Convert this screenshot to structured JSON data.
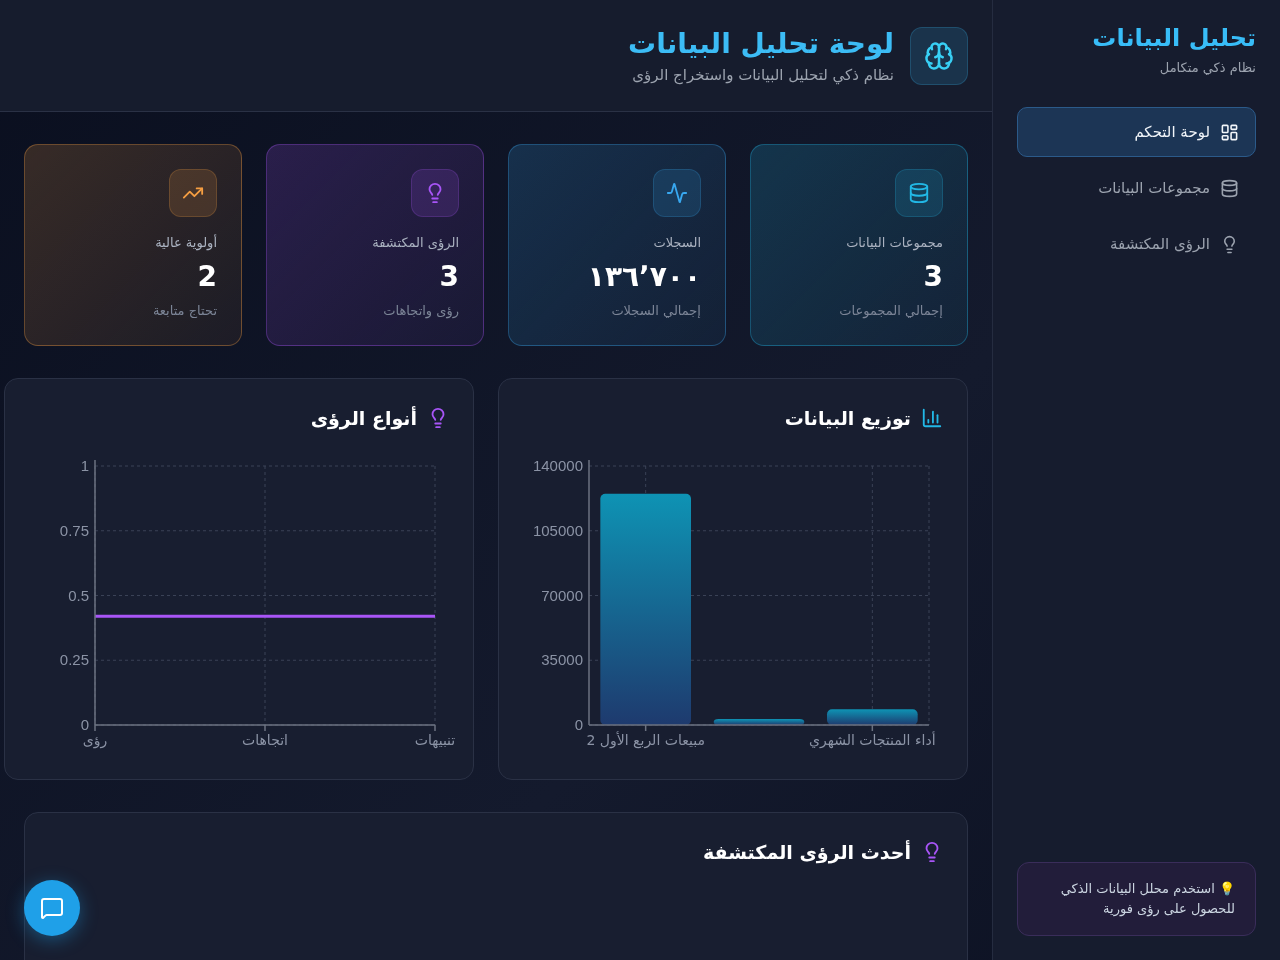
{
  "sidebar": {
    "title": "تحليل البيانات",
    "subtitle": "نظام ذكي متكامل",
    "items": [
      {
        "label": "لوحة التحكم",
        "selected": true
      },
      {
        "label": "مجموعات البيانات",
        "selected": false
      },
      {
        "label": "الرؤى المكتشفة",
        "selected": false
      }
    ],
    "tip": "💡 استخدم محلل البيانات الذكي للحصول على رؤى فورية"
  },
  "header": {
    "title": "لوحة تحليل البيانات",
    "subtitle": "نظام ذكي لتحليل البيانات واستخراج الرؤى"
  },
  "stats": [
    {
      "label": "مجموعات البيانات",
      "value": "3",
      "note": "إجمالي المجموعات",
      "color": "#22b8e6"
    },
    {
      "label": "السجلات",
      "value": "١٣٦٬٧٠٠",
      "note": "إجمالي السجلات",
      "color": "#38a8f0"
    },
    {
      "label": "الرؤى المكتشفة",
      "value": "3",
      "note": "رؤى واتجاهات",
      "color": "#a855f7"
    },
    {
      "label": "أولوية عالية",
      "value": "2",
      "note": "تحتاج متابعة",
      "color": "#f59e42"
    }
  ],
  "charts": [
    {
      "title": "توزيع البيانات",
      "chart_data": {
        "type": "bar",
        "values": [
          125000,
          3200,
          8500
        ],
        "categories": [
          "مبيعات الربع الأول 2",
          null,
          "أداء المنتجات الشهري"
        ],
        "grid": true,
        "ylim": [
          0,
          140000
        ],
        "yticks": [
          0,
          35000,
          70000,
          105000,
          140000
        ]
      }
    },
    {
      "title": "أنواع الرؤى",
      "chart_data": {
        "type": "line",
        "categories": [
          "رؤى",
          "اتجاهات",
          "تنبيهات"
        ],
        "series": [
          {
            "color": "#a855f7",
            "values": [
              0.42,
              0.42,
              0.42
            ]
          }
        ],
        "grid": true,
        "ylim": [
          0,
          1
        ],
        "yticks": [
          0,
          0.25,
          0.5,
          0.75,
          1
        ]
      }
    }
  ],
  "insights": {
    "title": "أحدث الرؤى المكتشفة"
  }
}
